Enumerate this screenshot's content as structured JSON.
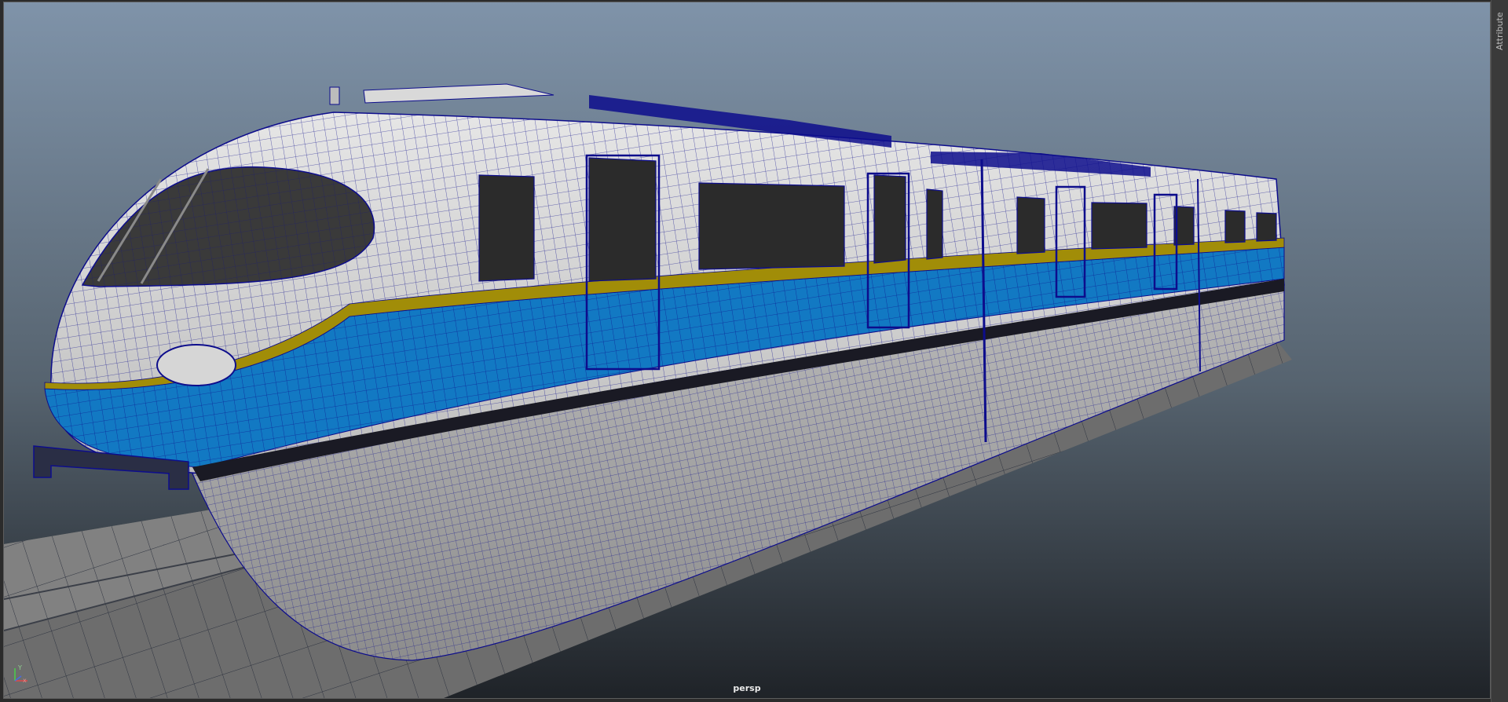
{
  "viewport": {
    "camera_label": "persp",
    "axis_labels": {
      "x": "x",
      "y": "Y"
    },
    "colors": {
      "background_top": "#7f93a9",
      "background_bottom": "#1f2328",
      "wireframe": "#0d0d8c",
      "body": "#dcdcdc",
      "blue_stripe": "#1279c3",
      "yellow_stripe": "#a18d08",
      "window": "#2b2b2b"
    }
  },
  "side_panel": {
    "attribute_editor_tab": "Attribute"
  }
}
